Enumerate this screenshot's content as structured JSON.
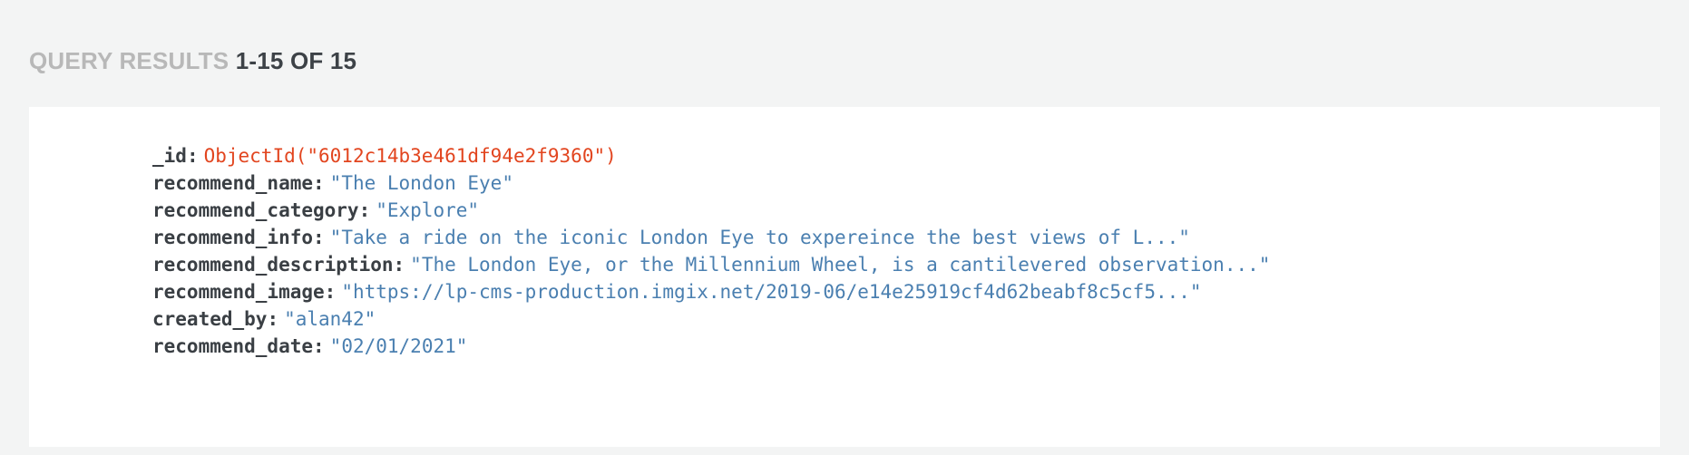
{
  "header": {
    "label": "QUERY RESULTS",
    "range": "1-15 OF 15"
  },
  "document": {
    "fields": [
      {
        "key": "_id",
        "value": "ObjectId(\"6012c14b3e461df94e2f9360\")",
        "type": "objectid"
      },
      {
        "key": "recommend_name",
        "value": "\"The London Eye\"",
        "type": "string"
      },
      {
        "key": "recommend_category",
        "value": "\"Explore\"",
        "type": "string"
      },
      {
        "key": "recommend_info",
        "value": "\"Take a ride on the iconic London Eye to expereince the best views of L...\"",
        "type": "string"
      },
      {
        "key": "recommend_description",
        "value": "\"The London Eye, or the Millennium Wheel, is a cantilevered observation...\"",
        "type": "string"
      },
      {
        "key": "recommend_image",
        "value": "\"https://lp-cms-production.imgix.net/2019-06/e14e25919cf4d62beabf8c5cf5...\"",
        "type": "string"
      },
      {
        "key": "created_by",
        "value": "\"alan42\"",
        "type": "string"
      },
      {
        "key": "recommend_date",
        "value": "\"02/01/2021\"",
        "type": "string"
      }
    ]
  },
  "colors": {
    "background": "#f3f4f4",
    "card": "#ffffff",
    "header_label": "#b8b8b8",
    "header_range": "#3d4247",
    "key": "#3a3f44",
    "string_value": "#4a7fb0",
    "objectid_value": "#e2451f"
  }
}
